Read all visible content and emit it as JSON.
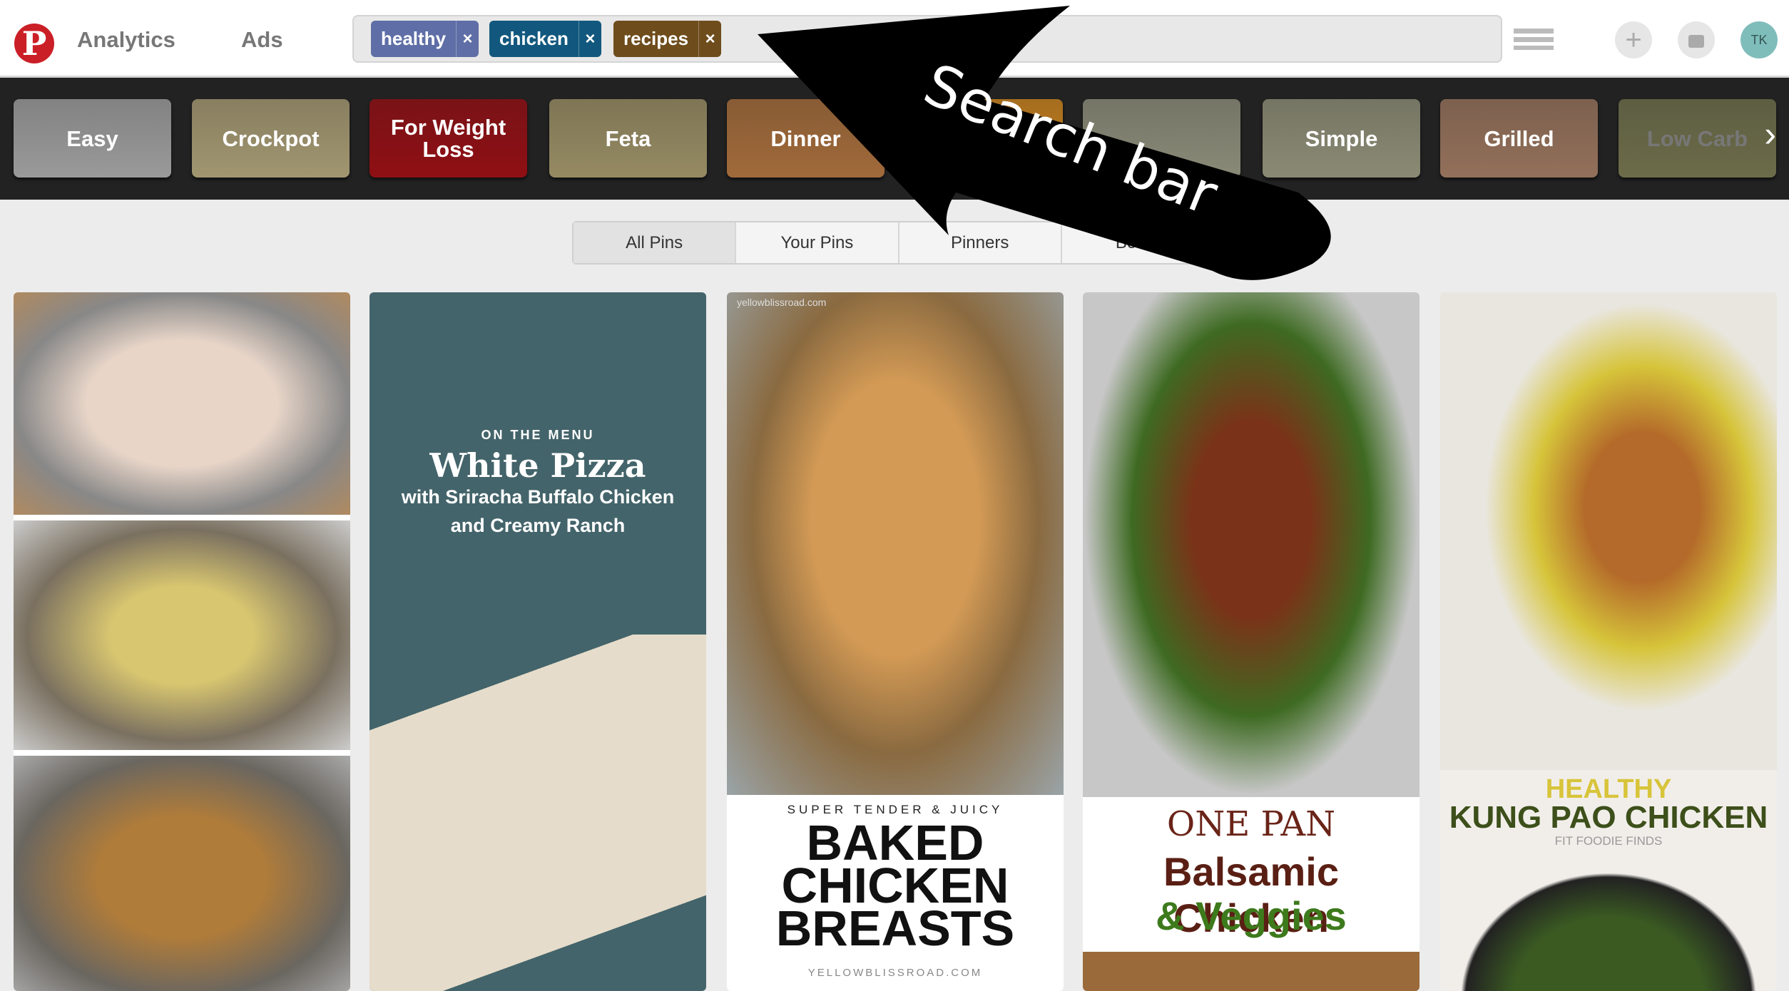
{
  "header": {
    "logo": "P",
    "nav": [
      "Analytics",
      "Ads"
    ],
    "search_chips": [
      {
        "label": "healthy",
        "color": "#5f6ea6"
      },
      {
        "label": "chicken",
        "color": "#12587e"
      },
      {
        "label": "recipes",
        "color": "#6e4c1c"
      }
    ],
    "remove_glyph": "×",
    "view_icon": "list-grid-icon",
    "add_glyph": "+",
    "message_icon": "speech-bubble-icon",
    "avatar": "TK"
  },
  "categories": [
    {
      "label": "Easy",
      "color": "#9a9a9a"
    },
    {
      "label": "Crockpot",
      "color": "#a19670"
    },
    {
      "label": "For Weight Loss",
      "color": "#8f0f14"
    },
    {
      "label": "Feta",
      "color": "#958a62"
    },
    {
      "label": "Dinner",
      "color": "#a16a3a"
    },
    {
      "label": "",
      "color": "#c6801e"
    },
    {
      "label": "",
      "color": "#8a8a78"
    },
    {
      "label": "Simple",
      "color": "#8a8a74"
    },
    {
      "label": "Grilled",
      "color": "#93705a"
    },
    {
      "label": "Low Carb",
      "color": "#6c6c4a"
    }
  ],
  "tabs": [
    "All Pins",
    "Your Pins",
    "Pinners",
    "Boards"
  ],
  "active_tab": "All Pins",
  "pins": [
    {},
    {
      "kicker": "ON THE MENU",
      "title": "White Pizza",
      "line1": "with Sriracha Buffalo Chicken",
      "line2": "and Creamy Ranch"
    },
    {
      "watermark": "yellowblissroad.com",
      "kicker": "SUPER TENDER & JUICY",
      "title": "BAKED CHICKEN BREASTS",
      "site": "YELLOWBLISSROAD.COM"
    },
    {
      "kicker": "ONE PAN",
      "title": "Balsamic Chicken",
      "line2": "& Veggies"
    },
    {
      "kicker": "HEALTHY",
      "title": "KUNG PAO CHICKEN",
      "site": "FIT FOODIE FINDS"
    }
  ],
  "annotation": {
    "text": "Search bar"
  }
}
